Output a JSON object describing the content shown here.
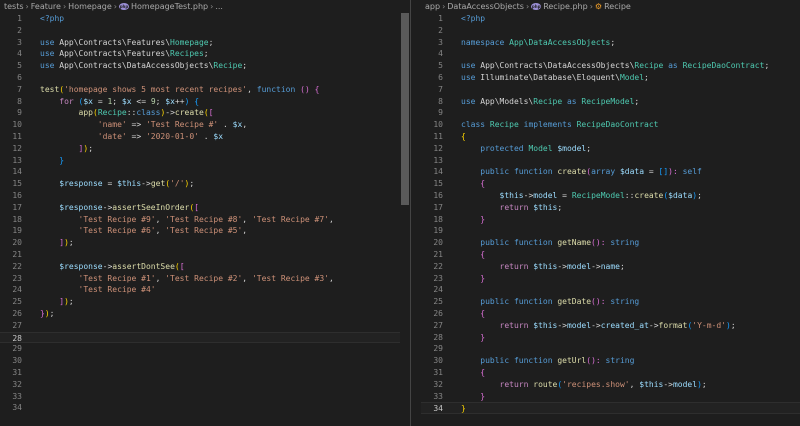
{
  "left": {
    "breadcrumbs": [
      "tests",
      "Feature",
      "Homepage",
      "HomepageTest.php",
      "..."
    ],
    "file_icon": "php-file-icon",
    "current_line": 28,
    "lines": [
      {
        "n": "1",
        "t": [
          [
            "<?php",
            "k"
          ]
        ]
      },
      {
        "n": "2",
        "t": []
      },
      {
        "n": "3",
        "t": [
          [
            "use ",
            "k"
          ],
          [
            "App\\Contracts\\Features\\",
            "p"
          ],
          [
            "Homepage",
            "t"
          ],
          [
            ";",
            "p"
          ]
        ]
      },
      {
        "n": "4",
        "t": [
          [
            "use ",
            "k"
          ],
          [
            "App\\Contracts\\Features\\",
            "p"
          ],
          [
            "Recipes",
            "t"
          ],
          [
            ";",
            "p"
          ]
        ]
      },
      {
        "n": "5",
        "t": [
          [
            "use ",
            "k"
          ],
          [
            "App\\Contracts\\DataAccessObjects\\",
            "p"
          ],
          [
            "Recipe",
            "t"
          ],
          [
            ";",
            "p"
          ]
        ]
      },
      {
        "n": "6",
        "t": []
      },
      {
        "n": "7",
        "t": [
          [
            "test",
            "f"
          ],
          [
            "(",
            "b1"
          ],
          [
            "'homepage shows 5 most recent recipes'",
            "s"
          ],
          [
            ", ",
            "p"
          ],
          [
            "function ",
            "k"
          ],
          [
            "() ",
            "b2"
          ],
          [
            "{",
            "b2"
          ]
        ]
      },
      {
        "n": "8",
        "t": [
          [
            "    for ",
            "c"
          ],
          [
            "(",
            "b3"
          ],
          [
            "$x",
            "v"
          ],
          [
            " = ",
            "p"
          ],
          [
            "1",
            "n"
          ],
          [
            "; ",
            "p"
          ],
          [
            "$x",
            "v"
          ],
          [
            " <= ",
            "p"
          ],
          [
            "9",
            "n"
          ],
          [
            "; ",
            "p"
          ],
          [
            "$x",
            "v"
          ],
          [
            "++",
            "p"
          ],
          [
            ") ",
            "b3"
          ],
          [
            "{",
            "b3"
          ]
        ]
      },
      {
        "n": "9",
        "t": [
          [
            "        app",
            "f"
          ],
          [
            "(",
            "b1"
          ],
          [
            "Recipe",
            "t"
          ],
          [
            "::",
            "p"
          ],
          [
            "class",
            "k"
          ],
          [
            ")",
            "b1"
          ],
          [
            "->",
            "p"
          ],
          [
            "create",
            "f"
          ],
          [
            "(",
            "b1"
          ],
          [
            "[",
            "b2"
          ]
        ]
      },
      {
        "n": "10",
        "t": [
          [
            "            'name'",
            "s"
          ],
          [
            " => ",
            "p"
          ],
          [
            "'Test Recipe #'",
            "s"
          ],
          [
            " . ",
            "p"
          ],
          [
            "$x",
            "v"
          ],
          [
            ",",
            "p"
          ]
        ]
      },
      {
        "n": "11",
        "t": [
          [
            "            'date'",
            "s"
          ],
          [
            " => ",
            "p"
          ],
          [
            "'2020-01-0'",
            "s"
          ],
          [
            " . ",
            "p"
          ],
          [
            "$x",
            "v"
          ]
        ]
      },
      {
        "n": "12",
        "t": [
          [
            "        ]",
            "b2"
          ],
          [
            ")",
            "b1"
          ],
          [
            ";",
            "p"
          ]
        ]
      },
      {
        "n": "13",
        "t": [
          [
            "    }",
            "b3"
          ]
        ]
      },
      {
        "n": "14",
        "t": []
      },
      {
        "n": "15",
        "t": [
          [
            "    $response",
            "v"
          ],
          [
            " = ",
            "p"
          ],
          [
            "$this",
            "v"
          ],
          [
            "->",
            "p"
          ],
          [
            "get",
            "f"
          ],
          [
            "(",
            "b1"
          ],
          [
            "'/'",
            "s"
          ],
          [
            ")",
            "b1"
          ],
          [
            ";",
            "p"
          ]
        ]
      },
      {
        "n": "16",
        "t": []
      },
      {
        "n": "17",
        "t": [
          [
            "    $response",
            "v"
          ],
          [
            "->",
            "p"
          ],
          [
            "assertSeeInOrder",
            "f"
          ],
          [
            "(",
            "b1"
          ],
          [
            "[",
            "b2"
          ]
        ]
      },
      {
        "n": "18",
        "t": [
          [
            "        'Test Recipe #9'",
            "s"
          ],
          [
            ", ",
            "p"
          ],
          [
            "'Test Recipe #8'",
            "s"
          ],
          [
            ", ",
            "p"
          ],
          [
            "'Test Recipe #7'",
            "s"
          ],
          [
            ",",
            "p"
          ]
        ]
      },
      {
        "n": "19",
        "t": [
          [
            "        'Test Recipe #6'",
            "s"
          ],
          [
            ", ",
            "p"
          ],
          [
            "'Test Recipe #5'",
            "s"
          ],
          [
            ",",
            "p"
          ]
        ]
      },
      {
        "n": "20",
        "t": [
          [
            "    ]",
            "b2"
          ],
          [
            ")",
            "b1"
          ],
          [
            ";",
            "p"
          ]
        ]
      },
      {
        "n": "21",
        "t": []
      },
      {
        "n": "22",
        "t": [
          [
            "    $response",
            "v"
          ],
          [
            "->",
            "p"
          ],
          [
            "assertDontSee",
            "f"
          ],
          [
            "(",
            "b1"
          ],
          [
            "[",
            "b2"
          ]
        ]
      },
      {
        "n": "23",
        "t": [
          [
            "        'Test Recipe #1'",
            "s"
          ],
          [
            ", ",
            "p"
          ],
          [
            "'Test Recipe #2'",
            "s"
          ],
          [
            ", ",
            "p"
          ],
          [
            "'Test Recipe #3'",
            "s"
          ],
          [
            ",",
            "p"
          ]
        ]
      },
      {
        "n": "24",
        "t": [
          [
            "        'Test Recipe #4'",
            "s"
          ]
        ]
      },
      {
        "n": "25",
        "t": [
          [
            "    ]",
            "b2"
          ],
          [
            ")",
            "b1"
          ],
          [
            ";",
            "p"
          ]
        ]
      },
      {
        "n": "26",
        "t": [
          [
            "}",
            "b2"
          ],
          [
            ")",
            "b1"
          ],
          [
            ";",
            "p"
          ]
        ]
      },
      {
        "n": "27",
        "t": []
      },
      {
        "n": "28",
        "t": []
      },
      {
        "n": "29",
        "t": []
      },
      {
        "n": "30",
        "t": []
      },
      {
        "n": "31",
        "t": []
      },
      {
        "n": "32",
        "t": []
      },
      {
        "n": "33",
        "t": []
      },
      {
        "n": "34",
        "t": []
      }
    ]
  },
  "right": {
    "breadcrumbs": [
      "app",
      "DataAccessObjects",
      "Recipe.php",
      "Recipe"
    ],
    "file_icon": "php-file-icon",
    "symbol_icon": "class-icon",
    "current_line": 34,
    "lines": [
      {
        "n": "1",
        "t": [
          [
            "<?php",
            "k"
          ]
        ]
      },
      {
        "n": "2",
        "t": []
      },
      {
        "n": "3",
        "t": [
          [
            "namespace ",
            "k"
          ],
          [
            "App\\DataAccessObjects",
            "t"
          ],
          [
            ";",
            "p"
          ]
        ]
      },
      {
        "n": "4",
        "t": []
      },
      {
        "n": "5",
        "t": [
          [
            "use ",
            "k"
          ],
          [
            "App\\Contracts\\DataAccessObjects\\",
            "p"
          ],
          [
            "Recipe",
            "t"
          ],
          [
            " as ",
            "k"
          ],
          [
            "RecipeDaoContract",
            "t"
          ],
          [
            ";",
            "p"
          ]
        ]
      },
      {
        "n": "6",
        "t": [
          [
            "use ",
            "k"
          ],
          [
            "Illuminate\\Database\\Eloquent\\",
            "p"
          ],
          [
            "Model",
            "t"
          ],
          [
            ";",
            "p"
          ]
        ]
      },
      {
        "n": "7",
        "t": []
      },
      {
        "n": "8",
        "t": [
          [
            "use ",
            "k"
          ],
          [
            "App\\Models\\",
            "p"
          ],
          [
            "Recipe",
            "t"
          ],
          [
            " as ",
            "k"
          ],
          [
            "RecipeModel",
            "t"
          ],
          [
            ";",
            "p"
          ]
        ]
      },
      {
        "n": "9",
        "t": []
      },
      {
        "n": "10",
        "t": [
          [
            "class ",
            "k"
          ],
          [
            "Recipe",
            "t"
          ],
          [
            " implements ",
            "k"
          ],
          [
            "RecipeDaoContract",
            "t"
          ]
        ]
      },
      {
        "n": "11",
        "t": [
          [
            "{",
            "b1"
          ]
        ]
      },
      {
        "n": "12",
        "t": [
          [
            "    protected ",
            "k"
          ],
          [
            "Model ",
            "t"
          ],
          [
            "$model",
            "v"
          ],
          [
            ";",
            "p"
          ]
        ]
      },
      {
        "n": "13",
        "t": []
      },
      {
        "n": "14",
        "t": [
          [
            "    public function ",
            "k"
          ],
          [
            "create",
            "f"
          ],
          [
            "(",
            "b2"
          ],
          [
            "array ",
            "k"
          ],
          [
            "$data",
            "v"
          ],
          [
            " = ",
            "p"
          ],
          [
            "[]",
            "b3"
          ],
          [
            "): ",
            "b2"
          ],
          [
            "self",
            "k"
          ]
        ]
      },
      {
        "n": "15",
        "t": [
          [
            "    {",
            "b2"
          ]
        ]
      },
      {
        "n": "16",
        "t": [
          [
            "        $this",
            "v"
          ],
          [
            "->",
            "p"
          ],
          [
            "model",
            "v"
          ],
          [
            " = ",
            "p"
          ],
          [
            "RecipeModel",
            "t"
          ],
          [
            "::",
            "p"
          ],
          [
            "create",
            "f"
          ],
          [
            "(",
            "b3"
          ],
          [
            "$data",
            "v"
          ],
          [
            ")",
            "b3"
          ],
          [
            ";",
            "p"
          ]
        ]
      },
      {
        "n": "17",
        "t": [
          [
            "        return ",
            "c"
          ],
          [
            "$this",
            "v"
          ],
          [
            ";",
            "p"
          ]
        ]
      },
      {
        "n": "18",
        "t": [
          [
            "    }",
            "b2"
          ]
        ]
      },
      {
        "n": "19",
        "t": []
      },
      {
        "n": "20",
        "t": [
          [
            "    public function ",
            "k"
          ],
          [
            "getName",
            "f"
          ],
          [
            "(",
            "b2"
          ],
          [
            "): ",
            "b2"
          ],
          [
            "string",
            "k"
          ]
        ]
      },
      {
        "n": "21",
        "t": [
          [
            "    {",
            "b2"
          ]
        ]
      },
      {
        "n": "22",
        "t": [
          [
            "        return ",
            "c"
          ],
          [
            "$this",
            "v"
          ],
          [
            "->",
            "p"
          ],
          [
            "model",
            "v"
          ],
          [
            "->",
            "p"
          ],
          [
            "name",
            "v"
          ],
          [
            ";",
            "p"
          ]
        ]
      },
      {
        "n": "23",
        "t": [
          [
            "    }",
            "b2"
          ]
        ]
      },
      {
        "n": "24",
        "t": []
      },
      {
        "n": "25",
        "t": [
          [
            "    public function ",
            "k"
          ],
          [
            "getDate",
            "f"
          ],
          [
            "(",
            "b2"
          ],
          [
            "): ",
            "b2"
          ],
          [
            "string",
            "k"
          ]
        ]
      },
      {
        "n": "26",
        "t": [
          [
            "    {",
            "b2"
          ]
        ]
      },
      {
        "n": "27",
        "t": [
          [
            "        return ",
            "c"
          ],
          [
            "$this",
            "v"
          ],
          [
            "->",
            "p"
          ],
          [
            "model",
            "v"
          ],
          [
            "->",
            "p"
          ],
          [
            "created_at",
            "v"
          ],
          [
            "->",
            "p"
          ],
          [
            "format",
            "f"
          ],
          [
            "(",
            "b3"
          ],
          [
            "'Y-m-d'",
            "s"
          ],
          [
            ")",
            "b3"
          ],
          [
            ";",
            "p"
          ]
        ]
      },
      {
        "n": "28",
        "t": [
          [
            "    }",
            "b2"
          ]
        ]
      },
      {
        "n": "29",
        "t": []
      },
      {
        "n": "30",
        "t": [
          [
            "    public function ",
            "k"
          ],
          [
            "getUrl",
            "f"
          ],
          [
            "(",
            "b2"
          ],
          [
            "): ",
            "b2"
          ],
          [
            "string",
            "k"
          ]
        ]
      },
      {
        "n": "31",
        "t": [
          [
            "    {",
            "b2"
          ]
        ]
      },
      {
        "n": "32",
        "t": [
          [
            "        return ",
            "c"
          ],
          [
            "route",
            "f"
          ],
          [
            "(",
            "b3"
          ],
          [
            "'recipes.show'",
            "s"
          ],
          [
            ", ",
            "p"
          ],
          [
            "$this",
            "v"
          ],
          [
            "->",
            "p"
          ],
          [
            "model",
            "v"
          ],
          [
            ")",
            "b3"
          ],
          [
            ";",
            "p"
          ]
        ]
      },
      {
        "n": "33",
        "t": [
          [
            "    }",
            "b2"
          ]
        ]
      },
      {
        "n": "34",
        "t": [
          [
            "}",
            "b1"
          ]
        ]
      }
    ]
  }
}
